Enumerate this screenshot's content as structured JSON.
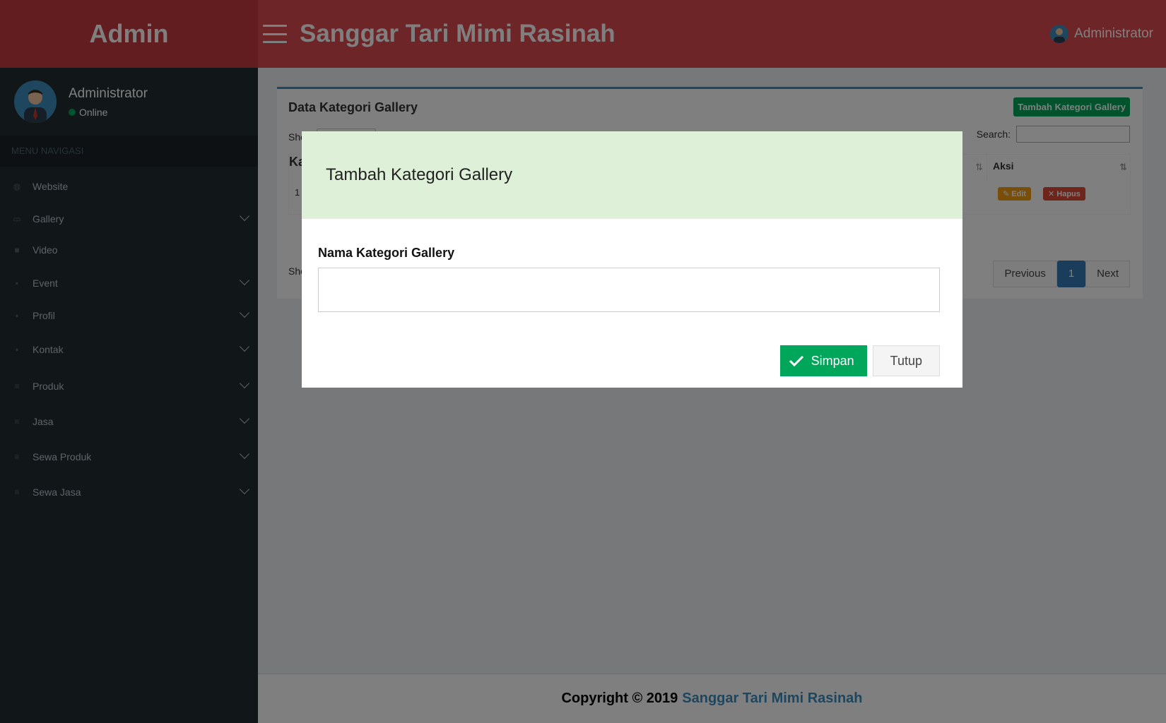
{
  "header": {
    "logo": "Admin",
    "title": "Sanggar Tari Mimi Rasinah",
    "user": "Administrator"
  },
  "sidebar": {
    "user_name": "Administrator",
    "user_status": "Online",
    "menu_header": "MENU NAVIGASI",
    "items": [
      {
        "label": "Website",
        "icon": "globe-icon",
        "has_children": false
      },
      {
        "label": "Gallery",
        "icon": "image-icon",
        "has_children": true
      },
      {
        "label": "Video",
        "icon": "video-icon",
        "has_children": false
      },
      {
        "label": "Event",
        "icon": "calendar-icon",
        "has_children": true
      },
      {
        "label": "Profil",
        "icon": "user-icon",
        "has_children": true
      },
      {
        "label": "Kontak",
        "icon": "phone-icon",
        "has_children": true
      },
      {
        "label": "Produk",
        "icon": "list-icon",
        "has_children": true
      },
      {
        "label": "Jasa",
        "icon": "list-icon",
        "has_children": true
      },
      {
        "label": "Sewa Produk",
        "icon": "list-icon",
        "has_children": true
      },
      {
        "label": "Sewa Jasa",
        "icon": "list-icon",
        "has_children": true
      }
    ]
  },
  "box": {
    "title": "Data Kategori Gallery",
    "add_button": "Tambah Kategori Gallery",
    "show_label": "Sho",
    "search_label": "Search:",
    "column_left_fragment": "Ka",
    "column_aksi": "Aksi",
    "row_number": "1",
    "edit_label": "Edit",
    "hapus_label": "Hapus",
    "showing_fragment": "Sho",
    "pagination": {
      "previous": "Previous",
      "current": "1",
      "next": "Next"
    }
  },
  "footer": {
    "copyright": "Copyright © 2019",
    "link": "Sanggar Tari Mimi Rasinah"
  },
  "modal": {
    "title": "Tambah Kategori Gallery",
    "field_label": "Nama Kategori Gallery",
    "field_value": "",
    "save_label": "Simpan",
    "close_label": "Tutup"
  },
  "colors": {
    "header_bg": "#dd4b4f",
    "logo_bg": "#c33b3f",
    "sidebar_bg": "#222d32",
    "modal_header_bg": "#dff0d8",
    "success": "#00a65a",
    "link": "#3c8dbc"
  }
}
